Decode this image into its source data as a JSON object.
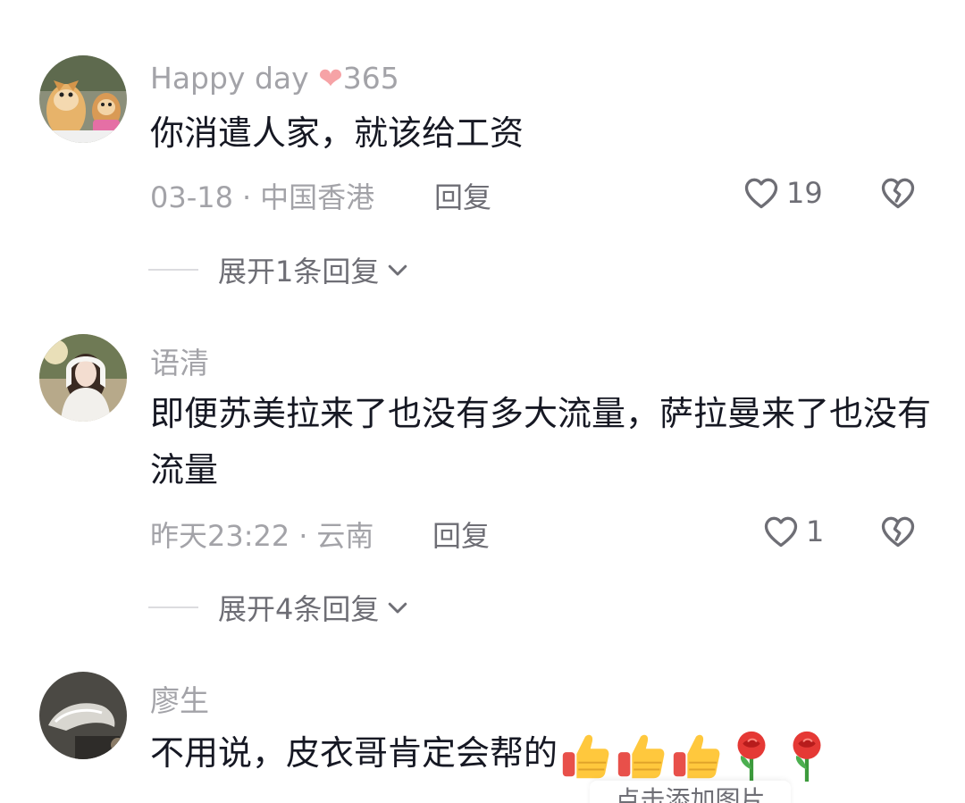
{
  "comments": [
    {
      "username": "Happy day ",
      "username_suffix": "365",
      "text": "你消遣人家，就该给工资",
      "date": "03-18",
      "location": "中国香港",
      "reply_label": "回复",
      "likes": "19",
      "expand_label": "展开1条回复"
    },
    {
      "username": "语清",
      "text": "即便苏美拉来了也没有多大流量，萨拉曼来了也没有流量",
      "date": "昨天23:22",
      "location": "云南",
      "reply_label": "回复",
      "likes": "1",
      "expand_label": "展开4条回复"
    },
    {
      "username": "廖生",
      "text": "不用说，皮衣哥肯定会帮的",
      "emojis": [
        "thumbs-up-icon",
        "thumbs-up-icon",
        "thumbs-up-icon",
        "rose-icon",
        "rose-icon"
      ]
    }
  ],
  "meta_separator": "·",
  "add_image_tip": "点击添加图片",
  "colors": {
    "text": "#161823",
    "secondary": "#a3a3a8",
    "action": "#6e6e75",
    "heart_emoji": "#f6a3a6"
  }
}
